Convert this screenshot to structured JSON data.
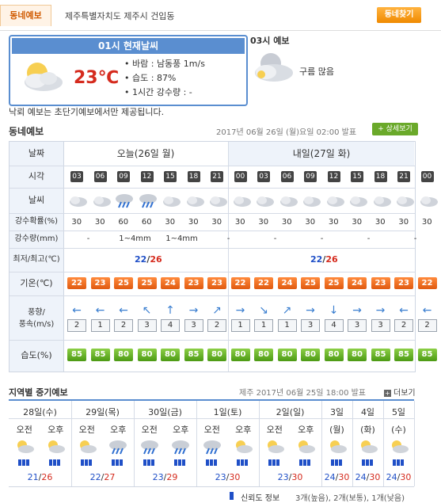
{
  "header": {
    "tab": "동네예보",
    "location": "제주특별자치도 제주시 건입동",
    "find_button": "동네찾기"
  },
  "current": {
    "title": "01시 현재날씨",
    "temperature": "23℃",
    "wind_label": "바람 : 남동풍 1m/s",
    "humidity_label": "습도 : 87%",
    "rain_label": "1시간 강수량 : -",
    "forecast3h_title": "03시 예보",
    "forecast3h_desc": "구름 많음",
    "note": "낙뢰 예보는 초단기예보에서만 제공됩니다."
  },
  "forecast": {
    "title": "동네예보",
    "issued": "2017년 06월 26일 (월)요일 02:00 발표",
    "detail_button": "+ 상세보기",
    "labels": {
      "date": "날짜",
      "time": "시각",
      "weather": "날씨",
      "prob": "강수확률(%)",
      "amount": "강수량(mm)",
      "minmax": "최저/최고(℃)",
      "temp": "기온(℃)",
      "wind": "풍향/\n풍속(m/s)",
      "humidity": "습도(%)"
    },
    "days": [
      {
        "label": "오늘(26일 월)"
      },
      {
        "label": "내일(27일 화)"
      }
    ],
    "times": [
      "03",
      "06",
      "09",
      "12",
      "15",
      "18",
      "21",
      "00",
      "03",
      "06",
      "09",
      "12",
      "15",
      "18",
      "21",
      "00"
    ],
    "weather_icons": [
      "cloud-icon",
      "cloud-icon",
      "cloud-rain-icon",
      "cloud-rain-icon",
      "cloud-icon",
      "cloud-icon",
      "cloud-icon",
      "cloud-icon",
      "cloud-icon",
      "cloud-icon",
      "cloud-icon",
      "cloud-icon",
      "cloud-icon",
      "cloud-icon",
      "cloud-icon",
      "cloud-icon"
    ],
    "prob": [
      "30",
      "30",
      "60",
      "60",
      "30",
      "30",
      "30",
      "30",
      "30",
      "30",
      "30",
      "30",
      "30",
      "30",
      "30",
      "30"
    ],
    "amounts": [
      "-",
      "1~4mm",
      "1~4mm",
      "-",
      "-",
      "-",
      "-",
      "-"
    ],
    "minmax": [
      {
        "min": "22",
        "max": "26"
      },
      {
        "min": "22",
        "max": "26"
      }
    ],
    "temps": [
      "22",
      "23",
      "25",
      "25",
      "24",
      "23",
      "23",
      "22",
      "22",
      "24",
      "25",
      "25",
      "24",
      "23",
      "23",
      "22"
    ],
    "wind_dirs": [
      "←",
      "←",
      "←",
      "↖",
      "↑",
      "→",
      "↗",
      "→",
      "↘",
      "↗",
      "→",
      "↓",
      "→",
      "→",
      "←",
      "←"
    ],
    "wind_speeds": [
      "2",
      "1",
      "2",
      "3",
      "4",
      "3",
      "2",
      "1",
      "1",
      "1",
      "3",
      "4",
      "3",
      "3",
      "2",
      "2"
    ],
    "humidity": [
      "85",
      "85",
      "80",
      "80",
      "80",
      "85",
      "80",
      "80",
      "80",
      "80",
      "80",
      "80",
      "80",
      "85",
      "85",
      "85"
    ]
  },
  "medium": {
    "title": "지역별 중기예보",
    "issued": "제주  2017년 06월 25일 18:00 발표",
    "more": "더보기",
    "days": [
      {
        "date": "28일(수)",
        "am": "오전",
        "pm": "오후",
        "temp_min": "21",
        "temp_max": "26"
      },
      {
        "date": "29일(목)",
        "am": "오전",
        "pm": "오후",
        "temp_min": "22",
        "temp_max": "27"
      },
      {
        "date": "30일(금)",
        "am": "오전",
        "pm": "오후",
        "temp_min": "23",
        "temp_max": "29"
      },
      {
        "date": "1일(토)",
        "am": "오전",
        "pm": "오후",
        "temp_min": "23",
        "temp_max": "30"
      },
      {
        "date": "2일(일)",
        "am": "오전",
        "pm": "오후",
        "temp_min": "23",
        "temp_max": "30"
      },
      {
        "date": "3일",
        "sub": "(월)",
        "temp_min": "24",
        "temp_max": "30"
      },
      {
        "date": "4일",
        "sub": "(화)",
        "temp_min": "24",
        "temp_max": "30"
      },
      {
        "date": "5일",
        "sub": "(수)",
        "temp_min": "24",
        "temp_max": "30"
      }
    ],
    "reliability": "신뢰도 정보",
    "reliability_levels": "3개(높음), 2개(보통), 1개(낮음)"
  },
  "colors": {
    "accent": "#5a8ed0",
    "temp": "#e05a10",
    "humid": "#4c9a14",
    "red": "#d52b1e",
    "blue": "#1f4fc7"
  }
}
